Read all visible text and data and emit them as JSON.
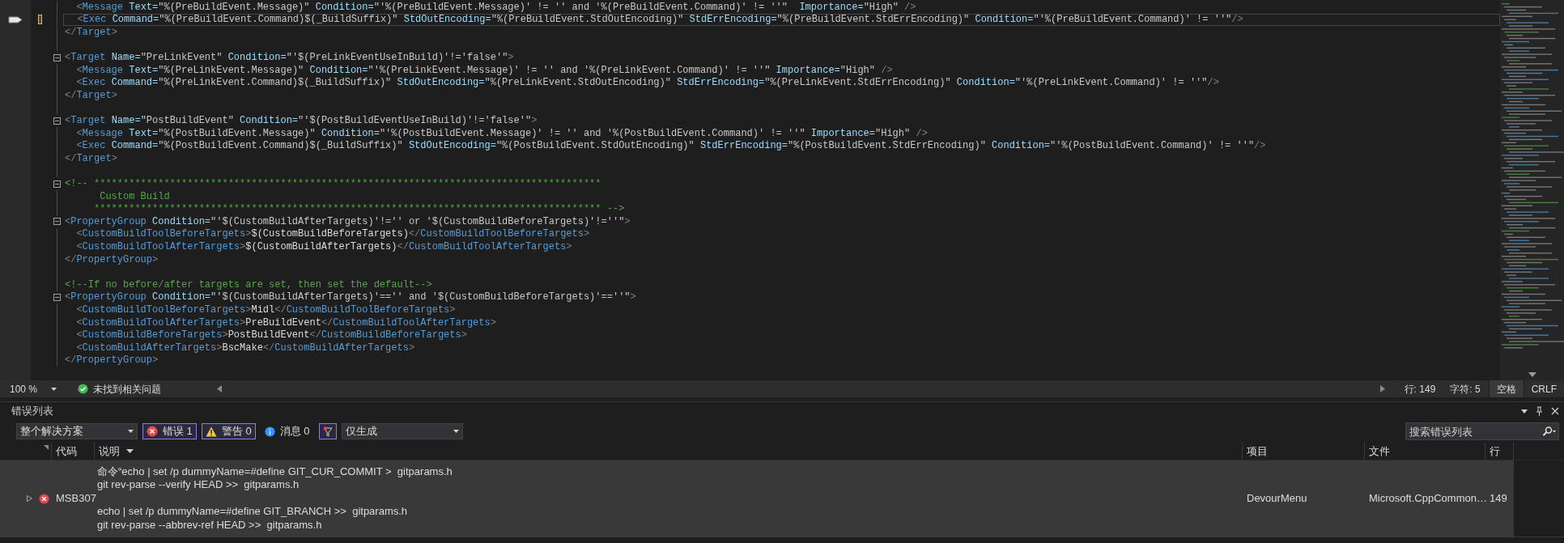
{
  "editor": {
    "lines": [
      {
        "kind": "code",
        "text": "  <Message Text=\"%(PreBuildEvent.Message)\" Condition=\"'%(PreBuildEvent.Message)' != '' and '%(PreBuildEvent.Command)' != ''\"  Importance=\"High\" />",
        "fold": false,
        "current": false
      },
      {
        "kind": "code",
        "text": "  <Exec Command=\"%(PreBuildEvent.Command)$(_BuildSuffix)\" StdOutEncoding=\"%(PreBuildEvent.StdOutEncoding)\" StdErrEncoding=\"%(PreBuildEvent.StdErrEncoding)\" Condition=\"'%(PreBuildEvent.Command)' != ''\"/>",
        "fold": false,
        "current": true
      },
      {
        "kind": "code",
        "text": "</Target>",
        "fold": false,
        "current": false
      },
      {
        "kind": "blank",
        "fold": false,
        "current": false
      },
      {
        "kind": "code",
        "text": "<Target Name=\"PreLinkEvent\" Condition=\"'$(PreLinkEventUseInBuild)'!='false'\">",
        "fold": true,
        "current": false
      },
      {
        "kind": "code",
        "text": "  <Message Text=\"%(PreLinkEvent.Message)\" Condition=\"'%(PreLinkEvent.Message)' != '' and '%(PreLinkEvent.Command)' != ''\" Importance=\"High\" />",
        "fold": false,
        "current": false
      },
      {
        "kind": "code",
        "text": "  <Exec Command=\"%(PreLinkEvent.Command)$(_BuildSuffix)\" StdOutEncoding=\"%(PreLinkEvent.StdOutEncoding)\" StdErrEncoding=\"%(PreLinkEvent.StdErrEncoding)\" Condition=\"'%(PreLinkEvent.Command)' != ''\"/>",
        "fold": false,
        "current": false
      },
      {
        "kind": "code",
        "text": "</Target>",
        "fold": false,
        "current": false
      },
      {
        "kind": "blank",
        "fold": false,
        "current": false
      },
      {
        "kind": "code",
        "text": "<Target Name=\"PostBuildEvent\" Condition=\"'$(PostBuildEventUseInBuild)'!='false'\">",
        "fold": true,
        "current": false
      },
      {
        "kind": "code",
        "text": "  <Message Text=\"%(PostBuildEvent.Message)\" Condition=\"'%(PostBuildEvent.Message)' != '' and '%(PostBuildEvent.Command)' != ''\" Importance=\"High\" />",
        "fold": false,
        "current": false
      },
      {
        "kind": "code",
        "text": "  <Exec Command=\"%(PostBuildEvent.Command)$(_BuildSuffix)\" StdOutEncoding=\"%(PostBuildEvent.StdOutEncoding)\" StdErrEncoding=\"%(PostBuildEvent.StdErrEncoding)\" Condition=\"'%(PostBuildEvent.Command)' != ''\"/>",
        "fold": false,
        "current": false
      },
      {
        "kind": "code",
        "text": "</Target>",
        "fold": false,
        "current": false
      },
      {
        "kind": "blank",
        "fold": false,
        "current": false
      },
      {
        "kind": "comment",
        "text": "<!-- ***************************************************************************************",
        "fold": true,
        "current": false
      },
      {
        "kind": "comment",
        "text": "      Custom Build",
        "fold": false,
        "current": false
      },
      {
        "kind": "comment",
        "text": "     *************************************************************************************** -->",
        "fold": false,
        "current": false
      },
      {
        "kind": "code",
        "text": "<PropertyGroup Condition=\"'$(CustomBuildAfterTargets)'!='' or '$(CustomBuildBeforeTargets)'!=''\">",
        "fold": true,
        "current": false
      },
      {
        "kind": "code",
        "text": "  <CustomBuildToolBeforeTargets>$(CustomBuildBeforeTargets)</CustomBuildToolBeforeTargets>",
        "fold": false,
        "current": false
      },
      {
        "kind": "code",
        "text": "  <CustomBuildToolAfterTargets>$(CustomBuildAfterTargets)</CustomBuildToolAfterTargets>",
        "fold": false,
        "current": false
      },
      {
        "kind": "code",
        "text": "</PropertyGroup>",
        "fold": false,
        "current": false
      },
      {
        "kind": "blank",
        "fold": false,
        "current": false
      },
      {
        "kind": "comment",
        "text": "<!--If no before/after targets are set, then set the default-->",
        "fold": false,
        "current": false
      },
      {
        "kind": "code",
        "text": "<PropertyGroup Condition=\"'$(CustomBuildAfterTargets)'=='' and '$(CustomBuildBeforeTargets)'==''\">",
        "fold": true,
        "current": false
      },
      {
        "kind": "code",
        "text": "  <CustomBuildToolBeforeTargets>Midl</CustomBuildToolBeforeTargets>",
        "fold": false,
        "current": false
      },
      {
        "kind": "code",
        "text": "  <CustomBuildToolAfterTargets>PreBuildEvent</CustomBuildToolAfterTargets>",
        "fold": false,
        "current": false
      },
      {
        "kind": "code",
        "text": "  <CustomBuildBeforeTargets>PostBuildEvent</CustomBuildBeforeTargets>",
        "fold": false,
        "current": false
      },
      {
        "kind": "code",
        "text": "  <CustomBuildAfterTargets>BscMake</CustomBuildAfterTargets>",
        "fold": false,
        "current": false
      },
      {
        "kind": "code",
        "text": "</PropertyGroup>",
        "fold": false,
        "current": false
      }
    ]
  },
  "status_bar": {
    "zoom": "100 %",
    "issues": "未找到相关问题",
    "line": "行: 149",
    "char": "字符: 5",
    "indent": "空格",
    "eol": "CRLF"
  },
  "error_list": {
    "title": "错误列表",
    "scope": "整个解决方案",
    "filters": [
      {
        "kind": "error",
        "label": "错误 1",
        "selected": true
      },
      {
        "kind": "warning",
        "label": "警告 0",
        "selected": true
      },
      {
        "kind": "message",
        "label": "消息 0",
        "selected": false
      }
    ],
    "build_filter": {
      "selected": true
    },
    "source": "仅生成",
    "search": {
      "placeholder": "搜索错误列表"
    },
    "columns": [
      "代码",
      "说明",
      "项目",
      "文件",
      "行"
    ],
    "rows": [
      {
        "expanded": false,
        "selected": true,
        "code": "MSB307",
        "description": "命令“echo | set /p dummyName=#define GIT_CUR_COMMIT >  gitparams.h\ngit rev-parse --verify HEAD >>  gitparams.h\n\necho | set /p dummyName=#define GIT_BRANCH >>  gitparams.h\ngit rev-parse --abbrev-ref HEAD >>  gitparams.h",
        "project": "DevourMenu",
        "file": "Microsoft.CppCommon…",
        "line": "149"
      }
    ]
  }
}
